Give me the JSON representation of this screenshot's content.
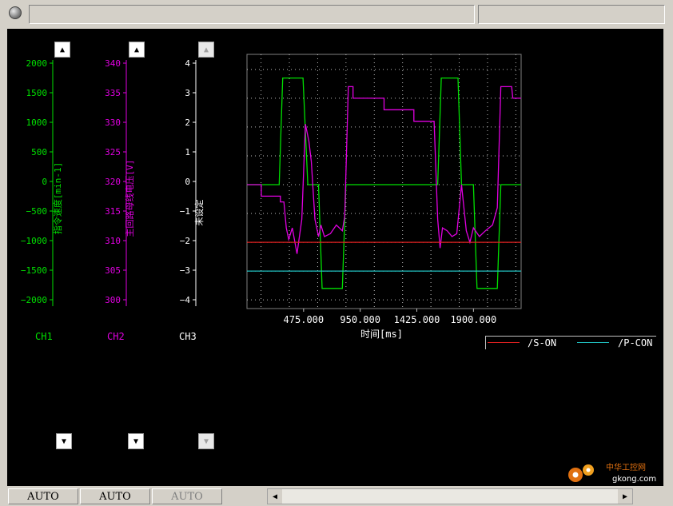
{
  "axes": {
    "ch1": {
      "title": "指令速度[min-1]",
      "ticks": [
        "2000",
        "1500",
        "1000",
        "500",
        "0",
        "−500",
        "−1000",
        "−1500",
        "−2000"
      ],
      "color": "#00e000"
    },
    "ch2": {
      "title": "主回路母线电压[V]",
      "ticks": [
        "340",
        "335",
        "330",
        "325",
        "320",
        "315",
        "310",
        "305",
        "300"
      ],
      "color": "#e000e0"
    },
    "ch3": {
      "title": "未设定",
      "ticks": [
        "4",
        "3",
        "2",
        "1",
        "0",
        "−1",
        "−2",
        "−3",
        "−4"
      ],
      "color": "#ffffff"
    }
  },
  "channels": [
    "CH1",
    "CH2",
    "CH3"
  ],
  "legend": [
    {
      "label": "/S-ON",
      "color": "#e02020"
    },
    {
      "label": "/P-CON",
      "color": "#20c0c0"
    }
  ],
  "bottom": {
    "auto_labels": [
      "AUTO",
      "AUTO",
      "AUTO"
    ]
  },
  "watermark": {
    "line1": "中华工控网",
    "line2": "gkong.com"
  },
  "chart_data": {
    "type": "line",
    "xlabel": "时间[ms]",
    "x_ticks": [
      "475.000",
      "950.000",
      "1425.000",
      "1900.000"
    ],
    "x_tick_values": [
      475,
      950,
      1425,
      1900
    ],
    "xlim": [
      0,
      2300
    ],
    "ylim": [
      -4.3,
      4.3
    ],
    "series": [
      {
        "name": "CH1",
        "color": "#00e000",
        "points": [
          [
            0,
            0
          ],
          [
            270,
            0
          ],
          [
            300,
            3.7
          ],
          [
            470,
            3.7
          ],
          [
            510,
            0
          ],
          [
            600,
            0
          ],
          [
            630,
            -3.6
          ],
          [
            800,
            -3.6
          ],
          [
            830,
            0
          ],
          [
            1600,
            0
          ],
          [
            1630,
            3.7
          ],
          [
            1770,
            3.7
          ],
          [
            1800,
            0
          ],
          [
            1900,
            0
          ],
          [
            1930,
            -3.6
          ],
          [
            2100,
            -3.6
          ],
          [
            2130,
            0
          ],
          [
            2300,
            0
          ]
        ]
      },
      {
        "name": "CH2",
        "color": "#e000e0",
        "points": [
          [
            0,
            0
          ],
          [
            120,
            0
          ],
          [
            120,
            -0.4
          ],
          [
            280,
            -0.4
          ],
          [
            280,
            -0.6
          ],
          [
            310,
            -0.6
          ],
          [
            330,
            -1.5
          ],
          [
            350,
            -1.9
          ],
          [
            380,
            -1.5
          ],
          [
            420,
            -2.4
          ],
          [
            460,
            -1.2
          ],
          [
            490,
            2.1
          ],
          [
            520,
            1.5
          ],
          [
            540,
            0.8
          ],
          [
            570,
            -1.2
          ],
          [
            600,
            -1.8
          ],
          [
            620,
            -1.4
          ],
          [
            650,
            -1.8
          ],
          [
            700,
            -1.7
          ],
          [
            750,
            -1.4
          ],
          [
            800,
            -1.6
          ],
          [
            820,
            -1.1
          ],
          [
            850,
            3.4
          ],
          [
            890,
            3.4
          ],
          [
            890,
            3.0
          ],
          [
            1150,
            3.0
          ],
          [
            1150,
            2.6
          ],
          [
            1400,
            2.6
          ],
          [
            1400,
            2.2
          ],
          [
            1570,
            2.2
          ],
          [
            1600,
            -1.2
          ],
          [
            1620,
            -2.2
          ],
          [
            1640,
            -1.5
          ],
          [
            1680,
            -1.6
          ],
          [
            1720,
            -1.8
          ],
          [
            1760,
            -1.7
          ],
          [
            1800,
            0.0
          ],
          [
            1840,
            -1.6
          ],
          [
            1870,
            -2.0
          ],
          [
            1900,
            -1.5
          ],
          [
            1950,
            -1.8
          ],
          [
            2000,
            -1.6
          ],
          [
            2060,
            -1.4
          ],
          [
            2100,
            -0.8
          ],
          [
            2130,
            3.4
          ],
          [
            2220,
            3.4
          ],
          [
            2230,
            3.0
          ],
          [
            2300,
            3.0
          ]
        ]
      },
      {
        "name": "/S-ON",
        "color": "#e02020",
        "points": [
          [
            0,
            -2
          ],
          [
            2300,
            -2
          ]
        ]
      },
      {
        "name": "/P-CON",
        "color": "#20c0c0",
        "points": [
          [
            0,
            -3
          ],
          [
            2300,
            -3
          ]
        ]
      }
    ]
  }
}
